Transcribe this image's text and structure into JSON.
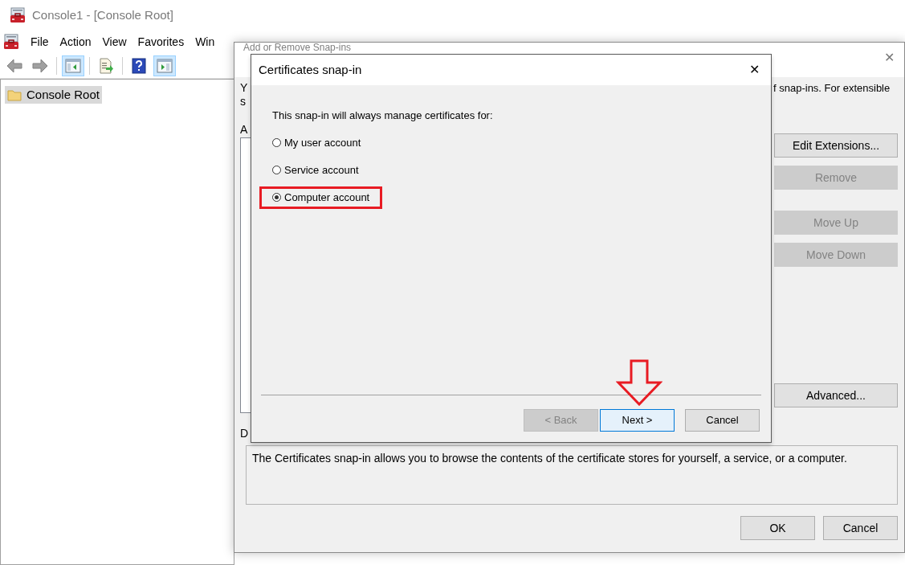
{
  "console": {
    "title": "Console1 - [Console Root]",
    "menu": [
      "File",
      "Action",
      "View",
      "Favorites",
      "Win"
    ],
    "toolbar": [
      {
        "kind": "back",
        "disabled": true
      },
      {
        "kind": "forward",
        "disabled": true
      },
      {
        "kind": "tree",
        "selected": true
      },
      {
        "kind": "export",
        "selected": false
      },
      {
        "kind": "help",
        "selected": false
      },
      {
        "kind": "pane",
        "selected": true
      }
    ],
    "tree": [
      {
        "label": "Console Root",
        "selected": true
      }
    ]
  },
  "snapins_dialog": {
    "title": "Add or Remove Snap-ins",
    "close": "✕",
    "intro_left": [
      "Y",
      "s"
    ],
    "intro_right": "f snap-ins. For extensible",
    "list_label": "A",
    "description_label": "D",
    "buttons": [
      {
        "label": "Edit Extensions...",
        "disabled": false
      },
      {
        "label": "Remove",
        "disabled": true
      },
      {
        "label": "Move Up",
        "disabled": true
      },
      {
        "label": "Move Down",
        "disabled": true
      },
      {
        "label": "Advanced...",
        "disabled": false
      }
    ],
    "description": "The Certificates snap-in allows you to browse the contents of the certificate stores for yourself, a service, or a computer.",
    "footer_buttons": [
      {
        "label": "OK"
      },
      {
        "label": "Cancel"
      }
    ]
  },
  "certificates_dialog": {
    "title": "Certificates snap-in",
    "close": "✕",
    "prompt": "This snap-in will always manage certificates for:",
    "options": [
      {
        "label": "My user account",
        "selected": false,
        "marked": false
      },
      {
        "label": "Service account",
        "selected": false,
        "marked": false
      },
      {
        "label": "Computer account",
        "selected": true,
        "marked": true
      }
    ],
    "buttons": [
      {
        "label": "< Back",
        "disabled": true,
        "focused": false,
        "arrow": false
      },
      {
        "label": "Next >",
        "disabled": false,
        "focused": true,
        "arrow": true
      },
      {
        "label": "Cancel",
        "disabled": false,
        "focused": false,
        "arrow": false
      }
    ]
  }
}
